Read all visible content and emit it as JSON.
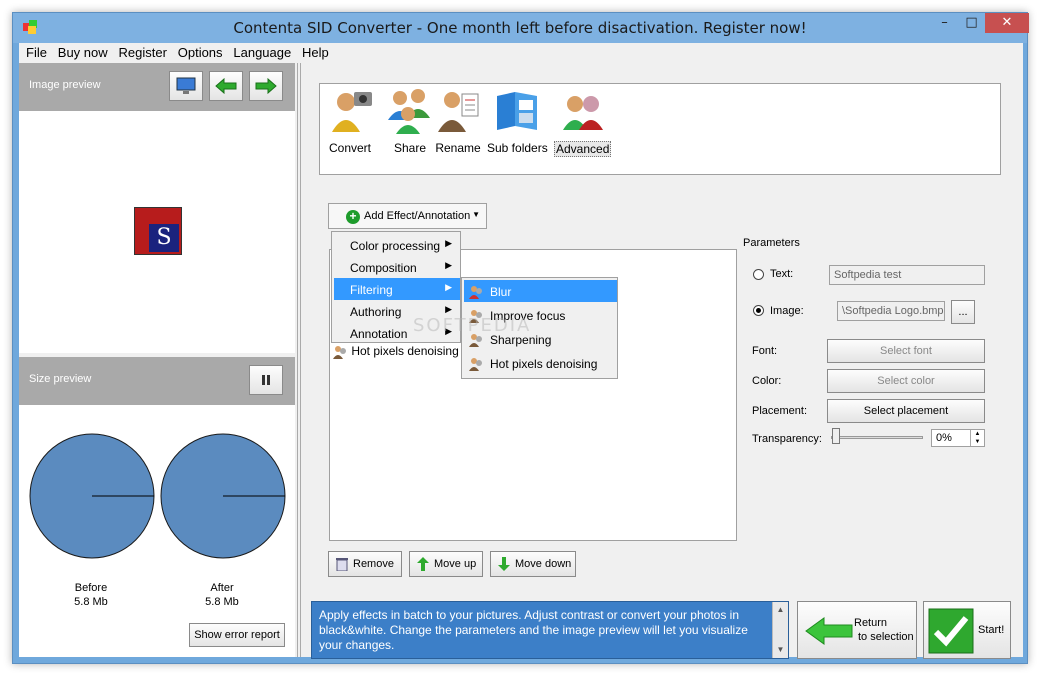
{
  "window": {
    "title": "Contenta SID Converter  - One month left before disactivation. Register now!",
    "minimize": "–",
    "maximize": "□",
    "close": "✕"
  },
  "menu": [
    "File",
    "Buy now",
    "Register",
    "Options",
    "Language",
    "Help"
  ],
  "left_panel": {
    "image_preview_label": "Image preview",
    "logo_letter": "S",
    "size_preview_label": "Size preview",
    "before_label": "Before",
    "before_size": "5.8 Mb",
    "after_label": "After",
    "after_size": "5.8 Mb",
    "error_report": "Show error report"
  },
  "toolbar": [
    "Convert",
    "Share",
    "Rename",
    "Sub folders",
    "Advanced"
  ],
  "effects": {
    "add_button": "Add Effect/Annotation",
    "list_item": "Hot pixels denoising",
    "menu": [
      "Color processing",
      "Composition",
      "Filtering",
      "Authoring",
      "Annotation"
    ],
    "submenu": [
      "Blur",
      "Improve focus",
      "Sharpening",
      "Hot pixels denoising"
    ]
  },
  "parameters": {
    "title": "Parameters",
    "text_label": "Text:",
    "text_value": "Softpedia test",
    "image_label": "Image:",
    "image_value": "\\Softpedia Logo.bmp",
    "browse": "...",
    "font_label": "Font:",
    "font_button": "Select font",
    "color_label": "Color:",
    "color_button": "Select color",
    "placement_label": "Placement:",
    "placement_button": "Select placement",
    "transparency_label": "Transparency:",
    "transparency_value": "0%"
  },
  "list_actions": {
    "remove": "Remove",
    "move_up": "Move up",
    "move_down": "Move down"
  },
  "info_text": "Apply effects in batch to your pictures. Adjust contrast or convert your photos in black&white. Change the parameters and the image preview will let you visualize your changes.",
  "return_button": {
    "line1": "Return",
    "line2": "to selection"
  },
  "start_button": "Start!",
  "watermark": "SOFTPEDIA",
  "colors": {
    "circle_fill": "#5b8bbf",
    "accent": "#3399ff",
    "info_bg": "#3c7fc8",
    "header_gray": "#a9a9a9"
  }
}
